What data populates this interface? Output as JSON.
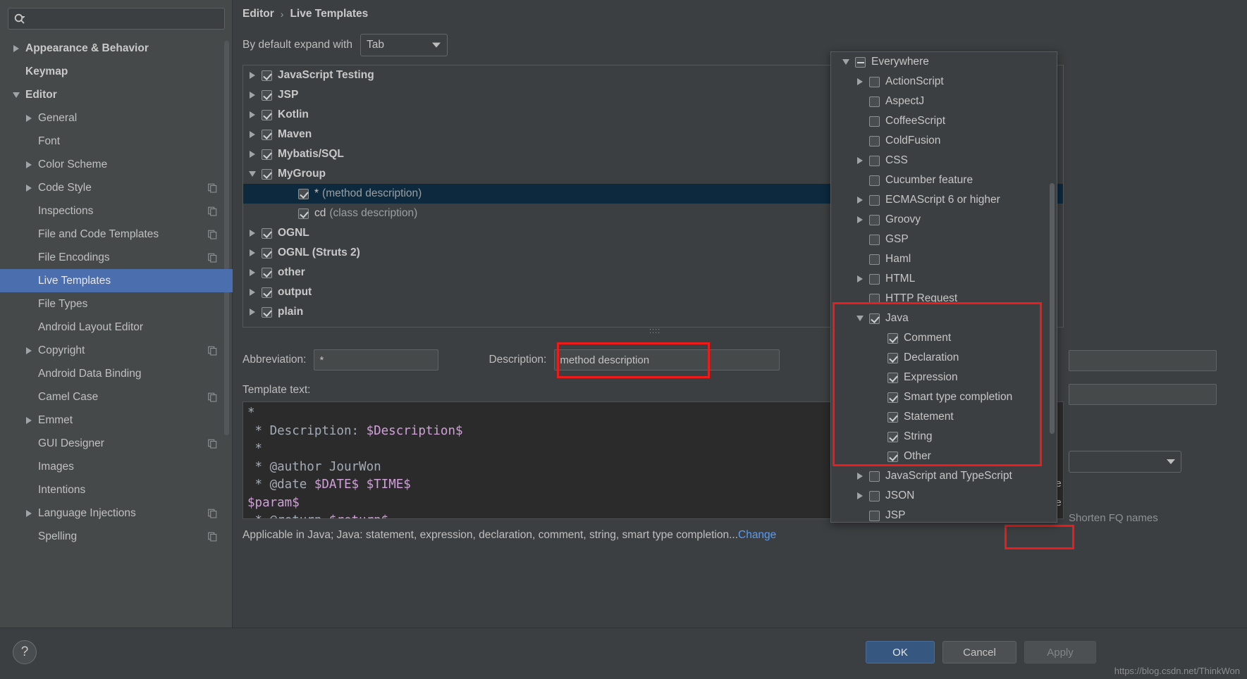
{
  "sidebar": {
    "search": {
      "placeholder": "",
      "value": "",
      "icon": "search-icon"
    },
    "items": [
      {
        "label": "Appearance & Behavior",
        "arrow": "right",
        "indent": 1,
        "bold": true,
        "copy": false,
        "selected": false
      },
      {
        "label": "Keymap",
        "arrow": "none",
        "indent": 1,
        "bold": true,
        "copy": false,
        "selected": false
      },
      {
        "label": "Editor",
        "arrow": "down",
        "indent": 1,
        "bold": true,
        "copy": false,
        "selected": false
      },
      {
        "label": "General",
        "arrow": "right",
        "indent": 2,
        "bold": false,
        "copy": false,
        "selected": false
      },
      {
        "label": "Font",
        "arrow": "none",
        "indent": 2,
        "bold": false,
        "copy": false,
        "selected": false
      },
      {
        "label": "Color Scheme",
        "arrow": "right",
        "indent": 2,
        "bold": false,
        "copy": false,
        "selected": false
      },
      {
        "label": "Code Style",
        "arrow": "right",
        "indent": 2,
        "bold": false,
        "copy": true,
        "selected": false
      },
      {
        "label": "Inspections",
        "arrow": "none",
        "indent": 2,
        "bold": false,
        "copy": true,
        "selected": false
      },
      {
        "label": "File and Code Templates",
        "arrow": "none",
        "indent": 2,
        "bold": false,
        "copy": true,
        "selected": false
      },
      {
        "label": "File Encodings",
        "arrow": "none",
        "indent": 2,
        "bold": false,
        "copy": true,
        "selected": false
      },
      {
        "label": "Live Templates",
        "arrow": "none",
        "indent": 2,
        "bold": false,
        "copy": false,
        "selected": true
      },
      {
        "label": "File Types",
        "arrow": "none",
        "indent": 2,
        "bold": false,
        "copy": false,
        "selected": false
      },
      {
        "label": "Android Layout Editor",
        "arrow": "none",
        "indent": 2,
        "bold": false,
        "copy": false,
        "selected": false
      },
      {
        "label": "Copyright",
        "arrow": "right",
        "indent": 2,
        "bold": false,
        "copy": true,
        "selected": false
      },
      {
        "label": "Android Data Binding",
        "arrow": "none",
        "indent": 2,
        "bold": false,
        "copy": false,
        "selected": false
      },
      {
        "label": "Camel Case",
        "arrow": "none",
        "indent": 2,
        "bold": false,
        "copy": true,
        "selected": false
      },
      {
        "label": "Emmet",
        "arrow": "right",
        "indent": 2,
        "bold": false,
        "copy": false,
        "selected": false
      },
      {
        "label": "GUI Designer",
        "arrow": "none",
        "indent": 2,
        "bold": false,
        "copy": true,
        "selected": false
      },
      {
        "label": "Images",
        "arrow": "none",
        "indent": 2,
        "bold": false,
        "copy": false,
        "selected": false
      },
      {
        "label": "Intentions",
        "arrow": "none",
        "indent": 2,
        "bold": false,
        "copy": false,
        "selected": false
      },
      {
        "label": "Language Injections",
        "arrow": "right",
        "indent": 2,
        "bold": false,
        "copy": true,
        "selected": false
      },
      {
        "label": "Spelling",
        "arrow": "none",
        "indent": 2,
        "bold": false,
        "copy": true,
        "selected": false
      }
    ]
  },
  "header": {
    "breadcrumb_root": "Editor",
    "breadcrumb_sep": "›",
    "breadcrumb_current": "Live Templates"
  },
  "expand": {
    "label": "By default expand with",
    "value": "Tab"
  },
  "templates": [
    {
      "label": "JavaScript Testing",
      "arrow": "right",
      "checked": true,
      "indent": 0,
      "bold": true,
      "selected": false,
      "desc": ""
    },
    {
      "label": "JSP",
      "arrow": "right",
      "checked": true,
      "indent": 0,
      "bold": true,
      "selected": false,
      "desc": ""
    },
    {
      "label": "Kotlin",
      "arrow": "right",
      "checked": true,
      "indent": 0,
      "bold": true,
      "selected": false,
      "desc": ""
    },
    {
      "label": "Maven",
      "arrow": "right",
      "checked": true,
      "indent": 0,
      "bold": true,
      "selected": false,
      "desc": ""
    },
    {
      "label": "Mybatis/SQL",
      "arrow": "right",
      "checked": true,
      "indent": 0,
      "bold": true,
      "selected": false,
      "desc": ""
    },
    {
      "label": "MyGroup",
      "arrow": "down",
      "checked": true,
      "indent": 0,
      "bold": true,
      "selected": false,
      "desc": ""
    },
    {
      "label": "*",
      "arrow": "none",
      "checked": true,
      "indent": 1,
      "bold": false,
      "selected": true,
      "desc": "(method description)"
    },
    {
      "label": "cd",
      "arrow": "none",
      "checked": true,
      "indent": 1,
      "bold": false,
      "selected": false,
      "desc": "(class description)"
    },
    {
      "label": "OGNL",
      "arrow": "right",
      "checked": true,
      "indent": 0,
      "bold": true,
      "selected": false,
      "desc": ""
    },
    {
      "label": "OGNL (Struts 2)",
      "arrow": "right",
      "checked": true,
      "indent": 0,
      "bold": true,
      "selected": false,
      "desc": ""
    },
    {
      "label": "other",
      "arrow": "right",
      "checked": true,
      "indent": 0,
      "bold": true,
      "selected": false,
      "desc": ""
    },
    {
      "label": "output",
      "arrow": "right",
      "checked": true,
      "indent": 0,
      "bold": true,
      "selected": false,
      "desc": ""
    },
    {
      "label": "plain",
      "arrow": "right",
      "checked": true,
      "indent": 0,
      "bold": true,
      "selected": false,
      "desc": ""
    }
  ],
  "editor_fields": {
    "abbreviation_label": "Abbreviation:",
    "abbreviation_value": "*",
    "description_label": "Description:",
    "description_value": "method description",
    "template_text_label": "Template text:"
  },
  "code": {
    "line1": "*",
    "line2_prefix": " * Description: ",
    "line2_var": "$Description$",
    "line3": " *",
    "line4": " * @author JourWon",
    "line5_prefix": " * @date ",
    "line5_var1": "$DATE$",
    "line5_var2": "$TIME$",
    "line6_var": "$param$",
    "line7_prefix": " * @return ",
    "line7_var": "$return$"
  },
  "applicable": {
    "text": "Applicable in Java; Java: statement, expression, declaration, comment, string, smart type completion...",
    "change_link": "Change"
  },
  "right_panel": {
    "partial_label_1": "le",
    "partial_label_2": "le",
    "shorten_label": "Shorten FQ names"
  },
  "toolbar": {
    "add": "+",
    "remove": "−",
    "copy": "copy-icon",
    "revert": "revert-icon"
  },
  "lang_popup": {
    "items": [
      {
        "label": "Everywhere",
        "arrow": "down",
        "state": "minus",
        "indent": 0,
        "red": false
      },
      {
        "label": "ActionScript",
        "arrow": "right",
        "state": "unchecked",
        "indent": 1,
        "red": false
      },
      {
        "label": "AspectJ",
        "arrow": "none",
        "state": "unchecked",
        "indent": 1,
        "red": false
      },
      {
        "label": "CoffeeScript",
        "arrow": "none",
        "state": "unchecked",
        "indent": 1,
        "red": false
      },
      {
        "label": "ColdFusion",
        "arrow": "none",
        "state": "unchecked",
        "indent": 1,
        "red": false
      },
      {
        "label": "CSS",
        "arrow": "right",
        "state": "unchecked",
        "indent": 1,
        "red": false
      },
      {
        "label": "Cucumber feature",
        "arrow": "none",
        "state": "unchecked",
        "indent": 1,
        "red": false
      },
      {
        "label": "ECMAScript 6 or higher",
        "arrow": "right",
        "state": "unchecked",
        "indent": 1,
        "red": false
      },
      {
        "label": "Groovy",
        "arrow": "right",
        "state": "unchecked",
        "indent": 1,
        "red": false
      },
      {
        "label": "GSP",
        "arrow": "none",
        "state": "unchecked",
        "indent": 1,
        "red": false
      },
      {
        "label": "Haml",
        "arrow": "none",
        "state": "unchecked",
        "indent": 1,
        "red": false
      },
      {
        "label": "HTML",
        "arrow": "right",
        "state": "unchecked",
        "indent": 1,
        "red": false
      },
      {
        "label": "HTTP Request",
        "arrow": "none",
        "state": "unchecked",
        "indent": 1,
        "red": false
      },
      {
        "label": "Java",
        "arrow": "down",
        "state": "checked",
        "indent": 1,
        "red": true
      },
      {
        "label": "Comment",
        "arrow": "none",
        "state": "checked",
        "indent": 2,
        "red": true
      },
      {
        "label": "Declaration",
        "arrow": "none",
        "state": "checked",
        "indent": 2,
        "red": true
      },
      {
        "label": "Expression",
        "arrow": "none",
        "state": "checked",
        "indent": 2,
        "red": true
      },
      {
        "label": "Smart type completion",
        "arrow": "none",
        "state": "checked",
        "indent": 2,
        "red": true
      },
      {
        "label": "Statement",
        "arrow": "none",
        "state": "checked",
        "indent": 2,
        "red": true
      },
      {
        "label": "String",
        "arrow": "none",
        "state": "checked",
        "indent": 2,
        "red": true
      },
      {
        "label": "Other",
        "arrow": "none",
        "state": "checked",
        "indent": 2,
        "red": true
      },
      {
        "label": "JavaScript and TypeScript",
        "arrow": "right",
        "state": "unchecked",
        "indent": 1,
        "red": false
      },
      {
        "label": "JSON",
        "arrow": "right",
        "state": "unchecked",
        "indent": 1,
        "red": false
      },
      {
        "label": "JSP",
        "arrow": "none",
        "state": "unchecked",
        "indent": 1,
        "red": false
      }
    ]
  },
  "buttons": {
    "ok": "OK",
    "cancel": "Cancel",
    "apply": "Apply",
    "help": "?"
  },
  "watermark": "https://blog.csdn.net/ThinkWon",
  "colors": {
    "accent_selected": "#4b6eaf",
    "tree_selected": "#0d293e",
    "highlight_red": "#ee1b1b",
    "link_blue": "#589df6",
    "panel_bg": "#3c3f41",
    "sidebar_bg": "#45494a",
    "code_bg": "#2b2b2b"
  }
}
